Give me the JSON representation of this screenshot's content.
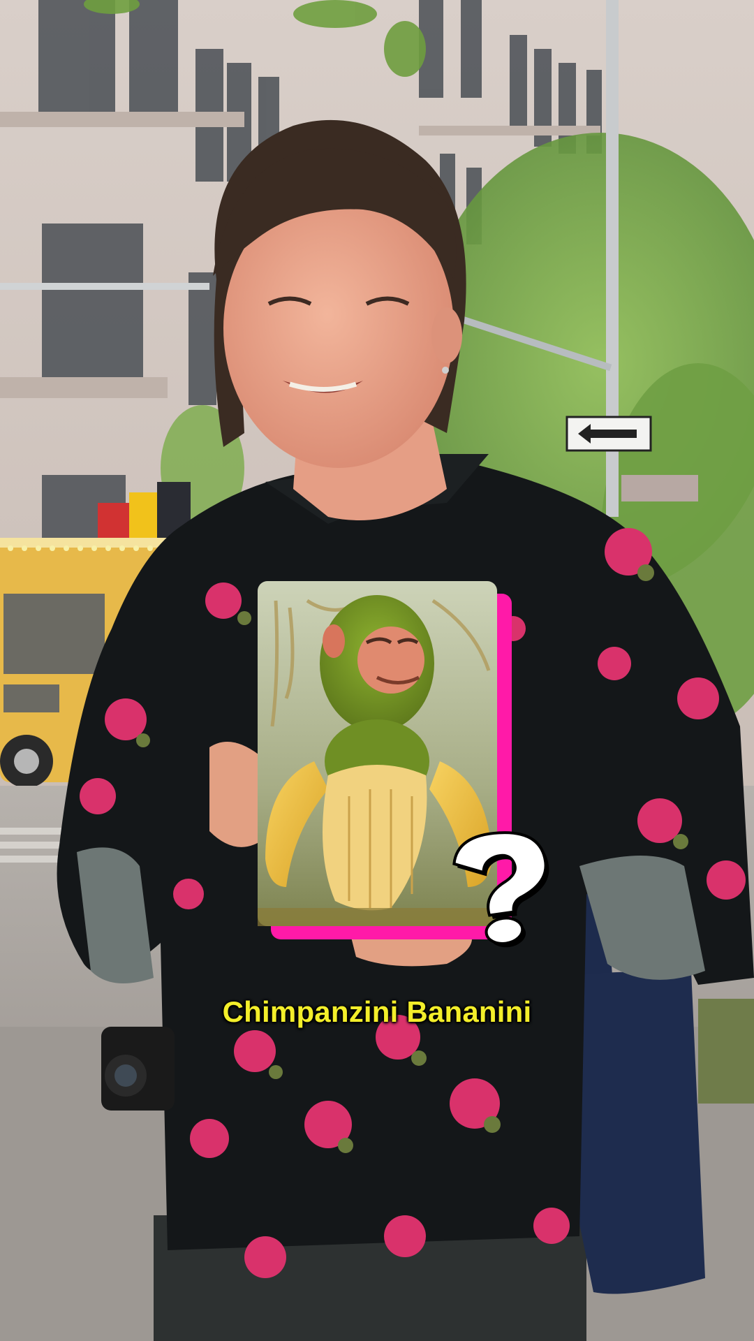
{
  "caption": "Chimpanzini Bananini",
  "colors": {
    "caption_text": "#f3ee2a",
    "card_accent": "#ff1aa8",
    "question_mark_fill": "#ffffff",
    "question_mark_outline": "#000000"
  },
  "shirt_pattern_color": "#d9326b",
  "icons": {
    "card_badge": "question-mark-icon"
  }
}
